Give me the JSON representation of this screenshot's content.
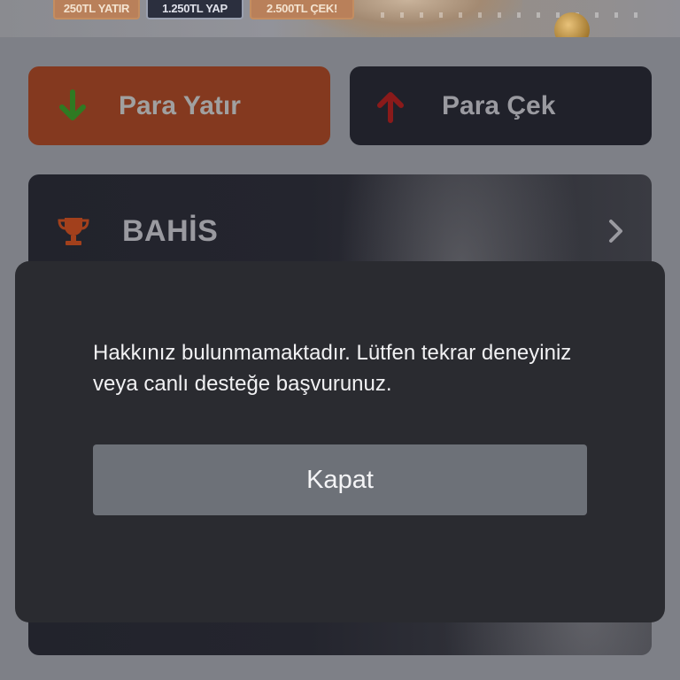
{
  "banner": {
    "promos": [
      "250TL YATIR",
      "1.250TL YAP",
      "2.500TL ÇEK!"
    ]
  },
  "actions": {
    "deposit_label": "Para Yatır",
    "withdraw_label": "Para Çek"
  },
  "menu": {
    "bahis_label": "BAHİS"
  },
  "modal": {
    "message": "Hakkınız bulunmamaktadır. Lütfen tekrar deneyiniz veya canlı desteğe başvurunuz.",
    "close_label": "Kapat"
  },
  "colors": {
    "deposit_bg": "#84391f",
    "withdraw_bg": "#20212a",
    "modal_bg": "#2a2b30",
    "modal_button_bg": "#6d7178",
    "deposit_arrow": "#2f7a22",
    "withdraw_arrow": "#8a1a1a",
    "trophy": "#a2401c"
  },
  "icons": {
    "deposit": "arrow-down-icon",
    "withdraw": "arrow-up-icon",
    "bahis": "trophy-icon",
    "bahis_chevron": "chevron-right-icon"
  }
}
